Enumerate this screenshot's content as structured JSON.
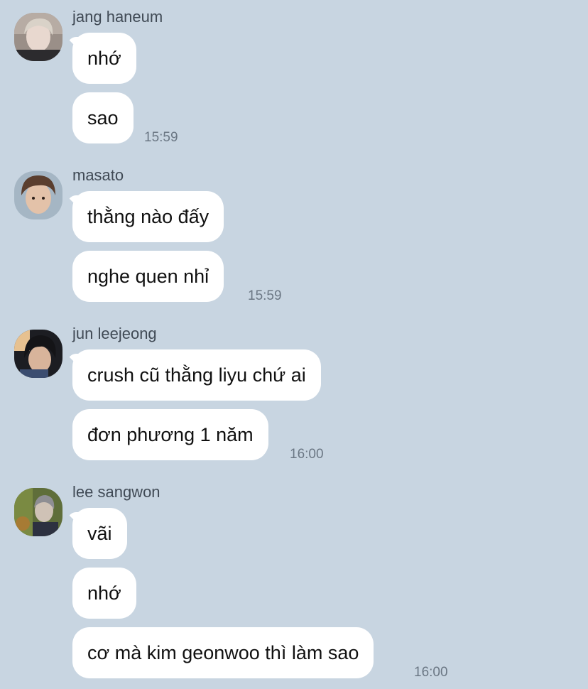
{
  "groups": [
    {
      "sender": "jang haneum",
      "avatar_icon": "profile-photo-icon",
      "messages": [
        {
          "text": "nhớ"
        },
        {
          "text": "sao"
        }
      ],
      "time": "15:59"
    },
    {
      "sender": "masato",
      "avatar_icon": "profile-photo-icon",
      "messages": [
        {
          "text": "thằng nào đấy"
        },
        {
          "text": "nghe quen nhỉ"
        }
      ],
      "time": "15:59"
    },
    {
      "sender": "jun leejeong",
      "avatar_icon": "profile-photo-icon",
      "messages": [
        {
          "text": "crush cũ thằng liyu chứ ai"
        },
        {
          "text": "đơn phương 1 năm"
        }
      ],
      "time": "16:00"
    },
    {
      "sender": "lee sangwon",
      "avatar_icon": "profile-photo-icon",
      "messages": [
        {
          "text": "vãi"
        },
        {
          "text": "nhớ"
        },
        {
          "text": "cơ mà kim geonwoo thì làm sao"
        }
      ],
      "time": "16:00"
    }
  ],
  "colors": {
    "background": "#c8d5e1",
    "bubble": "#ffffff",
    "sender_text": "#404a55",
    "time_text": "#6b7784"
  }
}
